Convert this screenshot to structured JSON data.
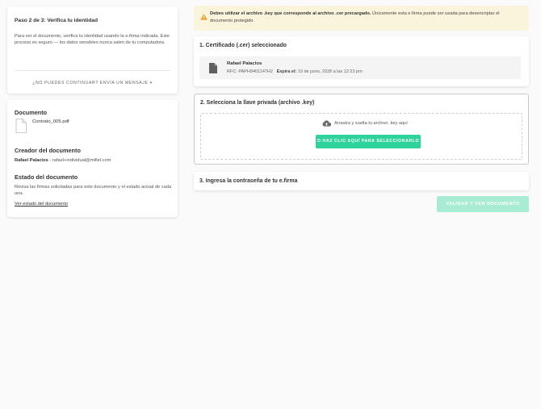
{
  "step": {
    "title": "Paso 2 de 3: Verifica tu identidad",
    "description": "Para ver el documento, verifica tu identidad usando la e.firma indicada. Este proceso es seguro — los datos sensibles nunca salen de tu computadora.",
    "help_link": "¿NO PUEDES CONTINUAR? ENVÍA UN MENSAJE"
  },
  "document": {
    "heading": "Documento",
    "file_name": "Contrato_005.pdf",
    "creator_heading": "Creador del documento",
    "creator_name": "Rafael Palacios",
    "creator_email": " - rafael+individual@mifiel.com",
    "status_heading": "Estado del documento",
    "status_description": "Revisa las firmas solicitadas para este documento y el estado actual de cada una.",
    "status_link": "Ver estado del documento"
  },
  "warning": {
    "bold": "Debes utilizar el archivo .key que corresponde al archivo .cer precargado.",
    "rest": " Únicamente esta e.firma puede ser usada para desencriptar el documento protegido."
  },
  "certificate": {
    "section_title": "1. Certificado (.cer) seleccionado",
    "name": "Rafael Palacios",
    "rfc": "RFC: PAPH9401147H2",
    "expires_label": "Expira el:",
    "expires_value": " 19 de junio, 2028 a las 12:23 pm"
  },
  "key": {
    "section_title": "2. Selecciona la llave privada (archivo .key)",
    "drop_text": "Arrastra y suelta tu archivo .key aquí",
    "select_button": "O HAZ CLIC AQUÍ PARA SELECCIONARLO"
  },
  "password": {
    "section_title": "3. Ingresa la contraseña de tu e.firma"
  },
  "actions": {
    "validate_button": "VALIDAR Y VER DOCUMENTO"
  },
  "colors": {
    "accent": "#2dd39a",
    "accent_disabled": "#a9ecd4",
    "warning_bg": "#fbf4dd",
    "warning_icon": "#f0a030"
  },
  "icons": {
    "warning": "warning-triangle-icon",
    "document": "document-file-icon",
    "certificate": "certificate-file-icon",
    "upload": "cloud-upload-icon",
    "chevron": "chevron-down-icon"
  }
}
